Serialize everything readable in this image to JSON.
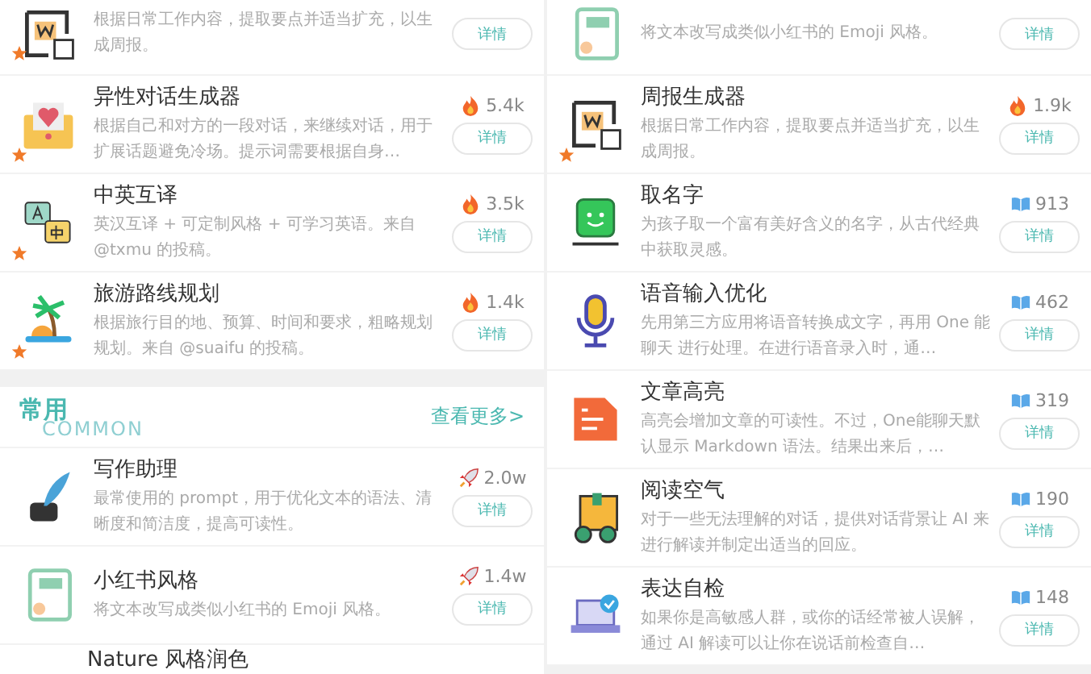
{
  "panels": [
    {
      "items": [
        {
          "kind": "partial",
          "starred": true,
          "description": "根据日常工作内容，提取要点并适当扩充，以生成周报。",
          "button": "详情"
        },
        {
          "kind": "tool",
          "starred": true,
          "title": "异性对话生成器",
          "description": "根据自己和对方的一段对话，来继续对话，用于扩展话题避免冷场。提示词需要根据自身…",
          "stat": {
            "kind": "fire",
            "count": "5.4k"
          },
          "button": "详情"
        },
        {
          "kind": "tool",
          "starred": true,
          "title": "中英互译",
          "description": "英汉互译 + 可定制风格 + 可学习英语。来自 @txmu 的投稿。",
          "stat": {
            "kind": "fire",
            "count": "3.5k"
          },
          "button": "详情"
        },
        {
          "kind": "tool",
          "starred": true,
          "title": "旅游路线规划",
          "description": "根据旅行目的地、预算、时间和要求，粗略规划规划。来自 @suaifu 的投稿。",
          "stat": {
            "kind": "fire",
            "count": "1.4k"
          },
          "button": "详情"
        },
        {
          "kind": "section",
          "title": "常用",
          "subtitle": "COMMON",
          "link": "查看更多>"
        },
        {
          "kind": "tool",
          "starred": false,
          "title": "写作助理",
          "description": "最常使用的 prompt，用于优化文本的语法、清晰度和简洁度，提高可读性。",
          "stat": {
            "kind": "rocket",
            "count": "2.0w"
          },
          "button": "详情"
        },
        {
          "kind": "tool",
          "starred": false,
          "title": "小红书风格",
          "description": "将文本改写成类似小红书的 Emoji 风格。",
          "stat": {
            "kind": "rocket",
            "count": "1.4w"
          },
          "button": "详情"
        },
        {
          "kind": "cut",
          "title": "Nature 风格润色"
        }
      ]
    },
    {
      "items": [
        {
          "kind": "partial",
          "starred": false,
          "description": "将文本改写成类似小红书的 Emoji 风格。",
          "button": "详情"
        },
        {
          "kind": "tool",
          "starred": true,
          "title": "周报生成器",
          "description": "根据日常工作内容，提取要点并适当扩充，以生成周报。",
          "stat": {
            "kind": "fire",
            "count": "1.9k"
          },
          "button": "详情"
        },
        {
          "kind": "tool",
          "starred": false,
          "title": "取名字",
          "description": "为孩子取一个富有美好含义的名字，从古代经典中获取灵感。",
          "stat": {
            "kind": "book",
            "count": "913"
          },
          "button": "详情"
        },
        {
          "kind": "tool",
          "starred": false,
          "title": "语音输入优化",
          "description": "先用第三方应用将语音转换成文字，再用 One 能聊天 进行处理。在进行语音录入时，通…",
          "stat": {
            "kind": "book",
            "count": "462"
          },
          "button": "详情"
        },
        {
          "kind": "tool",
          "starred": false,
          "title": "文章高亮",
          "description": "高亮会增加文章的可读性。不过，One能聊天默认显示 Markdown 语法。结果出来后，…",
          "stat": {
            "kind": "book",
            "count": "319"
          },
          "button": "详情"
        },
        {
          "kind": "tool",
          "starred": false,
          "title": "阅读空气",
          "description": "对于一些无法理解的对话，提供对话背景让 AI 来进行解读并制定出适当的回应。",
          "stat": {
            "kind": "book",
            "count": "190"
          },
          "button": "详情"
        },
        {
          "kind": "tool",
          "starred": false,
          "title": "表达自检",
          "description": "如果你是高敏感人群，或你的话经常被人误解，通过 AI 解读可以让你在说话前检查自…",
          "stat": {
            "kind": "book",
            "count": "148"
          },
          "button": "详情"
        },
        {
          "kind": "footer"
        }
      ]
    }
  ]
}
